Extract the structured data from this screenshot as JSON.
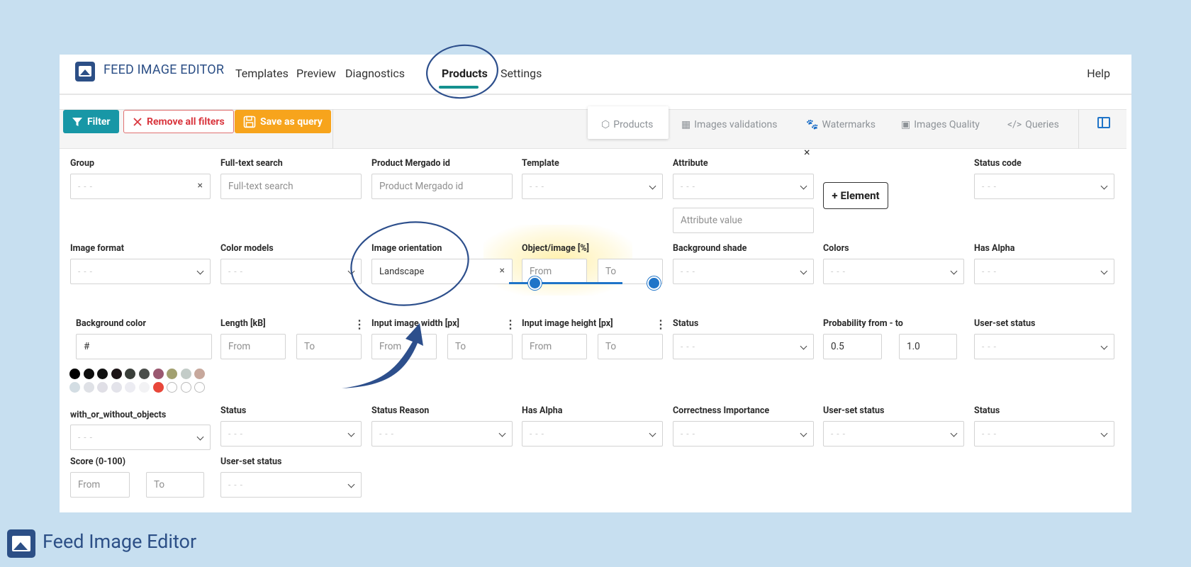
{
  "header": {
    "brand": "FEED IMAGE EDITOR",
    "nav": [
      "Templates",
      "Preview",
      "Diagnostics",
      "Products",
      "Settings"
    ],
    "active_nav": "Products",
    "help": "Help"
  },
  "toolbar": {
    "filter_label": "Filter",
    "remove_label": "Remove all filters",
    "save_label": "Save as query",
    "tabs": [
      "Products",
      "Images validations",
      "Watermarks",
      "Images Quality",
      "Queries"
    ],
    "active_tab": "Products"
  },
  "filters": {
    "placeholder_dots": "- - -",
    "from": "From",
    "to": "To",
    "group_label": "Group",
    "fulltext_label": "Full-text search",
    "fulltext_placeholder": "Full-text search",
    "mergado_label": "Product Mergado id",
    "mergado_placeholder": "Product Mergado id",
    "template_label": "Template",
    "attribute_label": "Attribute",
    "attribute_value_placeholder": "Attribute value",
    "element_button": "Element",
    "status_code_label": "Status code",
    "image_format_label": "Image format",
    "color_models_label": "Color models",
    "orientation_label": "Image orientation",
    "orientation_value": "Landscape",
    "object_image_label": "Object/image [%]",
    "object_image_range": [
      0,
      100
    ],
    "bg_shade_label": "Background shade",
    "colors_label": "Colors",
    "has_alpha_label": "Has Alpha",
    "bg_color_label": "Background color",
    "bg_color_placeholder": "#",
    "length_label": "Length [kB]",
    "width_label": "Input image width [px]",
    "height_label": "Input image height [px]",
    "status_label": "Status",
    "probability_label": "Probability from - to",
    "probability_from": "0.5",
    "probability_to": "1.0",
    "user_status_label": "User-set status",
    "with_objects_label": "with_or_without_objects",
    "status2_label": "Status",
    "status_reason_label": "Status Reason",
    "has_alpha2_label": "Has Alpha",
    "correctness_label": "Correctness Importance",
    "user_status2_label": "User-set status",
    "status3_label": "Status",
    "score_label": "Score (0-100)",
    "user_status3_label": "User-set status"
  },
  "swatches": {
    "row1": [
      "#000000",
      "#0d0d0d",
      "#111111",
      "#1c1416",
      "#3a3f3a",
      "#4a4d4a",
      "#9a5870",
      "#a2a070",
      "#c3ccc8",
      "#c7a89c"
    ],
    "row2": [
      "#d3dde3",
      "#dfe1e6",
      "#e0dfe6",
      "#e3e3ea",
      "#ececf2",
      "#f2f2f4",
      "#e8473a",
      "#ffffff",
      "#ffffff",
      "#ffffff"
    ]
  },
  "footer": {
    "brand": "Feed Image Editor"
  },
  "colors": {
    "accent": "#14908e",
    "brand": "#2c4f86",
    "filter": "#1897a6",
    "save": "#f7a41c",
    "remove": "#d9363e",
    "annotation": "#2d4f8c"
  }
}
